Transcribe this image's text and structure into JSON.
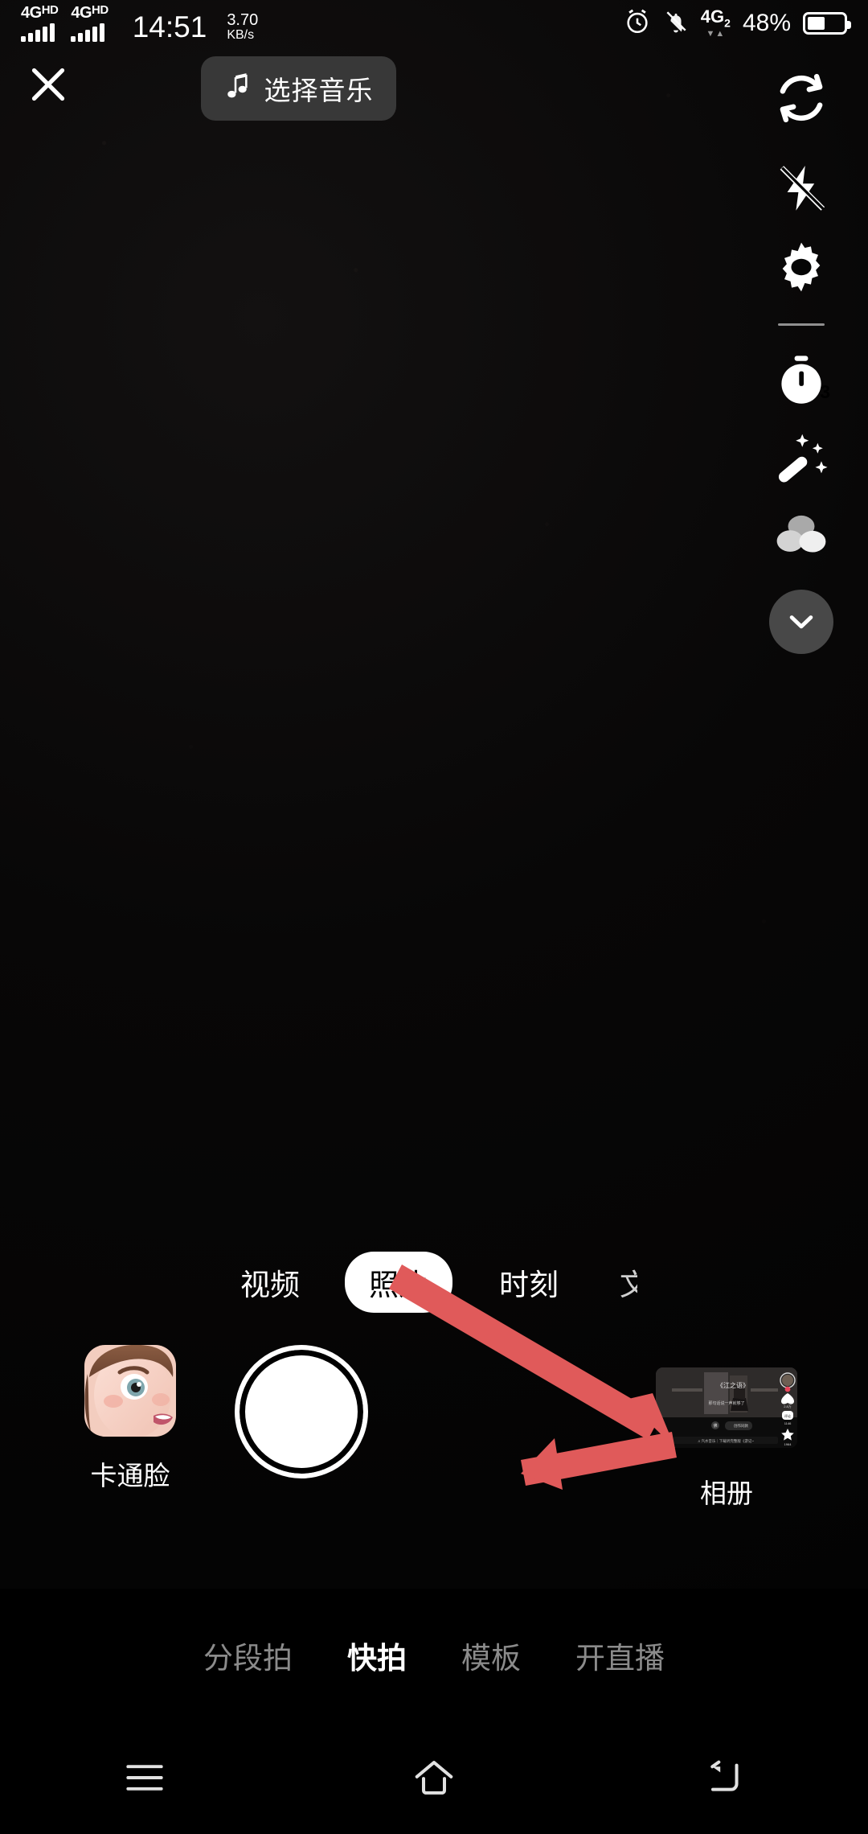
{
  "status_bar": {
    "sim1_network": "4G",
    "sim1_network_sup": "HD",
    "sim2_network": "4G",
    "sim2_network_sup": "HD",
    "time": "14:51",
    "net_speed_value": "3.70",
    "net_speed_unit": "KB/s",
    "alarm_icon": "alarm-clock-icon",
    "silent_icon": "bell-muted-icon",
    "data_network": "4G",
    "data_network_sub": "2",
    "data_arrows": "▼▲",
    "battery_percent": "48%",
    "battery_level": 48
  },
  "top_bar": {
    "close_label": "close",
    "music_icon": "music-note-icon",
    "music_label": "选择音乐"
  },
  "right_rail": [
    {
      "name": "flip-camera-icon",
      "label": "翻转"
    },
    {
      "name": "flash-off-icon",
      "label": "闪光灯关"
    },
    {
      "name": "settings-gear-icon",
      "label": "设置"
    },
    {
      "name": "timer-icon",
      "label": "倒计时",
      "badge": "3"
    },
    {
      "name": "beauty-wand-icon",
      "label": "美化"
    },
    {
      "name": "filters-icon",
      "label": "滤镜"
    },
    {
      "name": "chevron-down-icon",
      "label": "展开"
    }
  ],
  "camera_modes": [
    {
      "label": "视频",
      "selected": false
    },
    {
      "label": "照片",
      "selected": true
    },
    {
      "label": "时刻",
      "selected": false
    },
    {
      "label": "文",
      "selected": false
    }
  ],
  "capture": {
    "effect_label": "卡通脸",
    "effect_icon": "cartoon-face-thumbnail",
    "shutter_label": "拍摄",
    "album_label": "相册",
    "album_icon": "album-thumbnail"
  },
  "bottom_nav": [
    {
      "label": "分段拍",
      "active": false
    },
    {
      "label": "快拍",
      "active": true
    },
    {
      "label": "模板",
      "active": false
    },
    {
      "label": "开直播",
      "active": false
    }
  ],
  "android_nav": [
    {
      "name": "recents-icon",
      "label": "多任务"
    },
    {
      "name": "home-icon",
      "label": "主页"
    },
    {
      "name": "back-icon",
      "label": "返回"
    }
  ],
  "annotations": {
    "arrow_color": "#e05a5a",
    "arrow_count": 2,
    "points_to": "相册"
  },
  "colors": {
    "background": "#000000",
    "accent_white": "#ffffff",
    "inactive_gray": "#8b8b8b",
    "pill_gray": "#3c3c3c",
    "annotation_red": "#e05a5a"
  }
}
